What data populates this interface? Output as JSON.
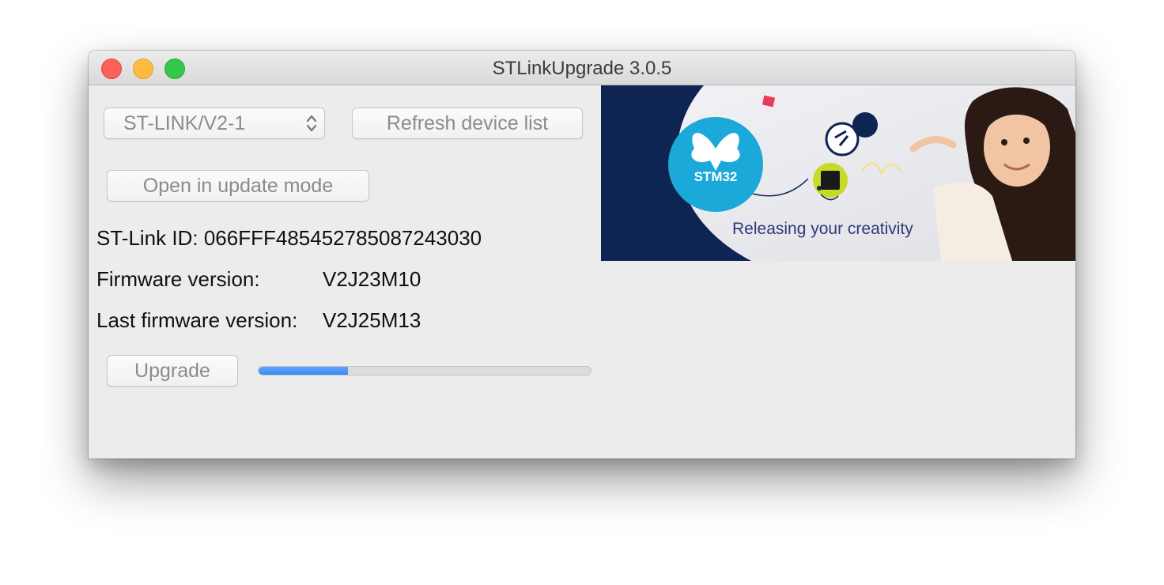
{
  "window": {
    "title": "STLinkUpgrade 3.0.5"
  },
  "device_select": {
    "selected": "ST-LINK/V2-1"
  },
  "buttons": {
    "refresh": "Refresh device list",
    "open_update_mode": "Open in update mode",
    "upgrade": "Upgrade"
  },
  "info": {
    "id_label": "ST-Link ID:",
    "id_value": "066FFF485452785087243030",
    "firmware_label": "Firmware version:",
    "firmware_value": "V2J23M10",
    "last_label": "Last firmware version:",
    "last_value": "V2J25M13"
  },
  "progress": {
    "value": 0.27
  },
  "banner": {
    "logo_text": "STM32",
    "tagline": "Releasing your creativity"
  },
  "colors": {
    "accent": "#3b87f2",
    "banner_navy": "#0e2452",
    "logo_blue": "#1aa9d9"
  }
}
